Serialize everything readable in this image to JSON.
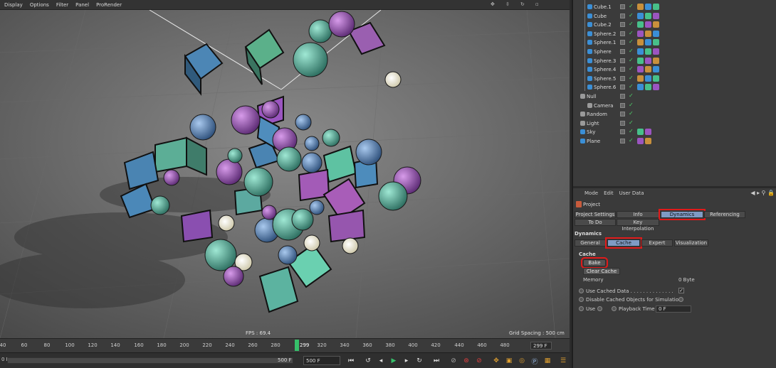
{
  "viewport": {
    "menu": [
      "Display",
      "Options",
      "Filter",
      "Panel",
      "ProRender"
    ],
    "fps": "FPS : 69.4",
    "grid_spacing": "Grid Spacing : 500 cm"
  },
  "timeline": {
    "ticks": [
      "40",
      "60",
      "80",
      "100",
      "120",
      "140",
      "160",
      "180",
      "200",
      "220",
      "240",
      "260",
      "280",
      "300",
      "320",
      "340",
      "360",
      "380",
      "400",
      "420",
      "440",
      "460",
      "480",
      "500"
    ],
    "current_frame": "299",
    "end_field": "299 F"
  },
  "transport": {
    "start": "0 F",
    "range_end": "500 F",
    "max_field": "500 F"
  },
  "objects": [
    {
      "name": "Cube.1",
      "color": "#3b8fd6"
    },
    {
      "name": "Cube",
      "color": "#3b8fd6"
    },
    {
      "name": "Cube.2",
      "color": "#3b8fd6"
    },
    {
      "name": "Sphere.2",
      "color": "#3b8fd6"
    },
    {
      "name": "Sphere.1",
      "color": "#3b8fd6"
    },
    {
      "name": "Sphere",
      "color": "#3b8fd6"
    },
    {
      "name": "Sphere.3",
      "color": "#3b8fd6"
    },
    {
      "name": "Sphere.4",
      "color": "#3b8fd6"
    },
    {
      "name": "Sphere.5",
      "color": "#3b8fd6"
    },
    {
      "name": "Sphere.6",
      "color": "#3b8fd6"
    },
    {
      "name": "Null",
      "color": "#9a9a9a"
    },
    {
      "name": "Camera",
      "color": "#9a9a9a"
    },
    {
      "name": "Random",
      "color": "#9a9a9a"
    },
    {
      "name": "Light",
      "color": "#9a9a9a"
    },
    {
      "name": "Sky",
      "color": "#3b8fd6"
    },
    {
      "name": "Plane",
      "color": "#3b8fd6"
    }
  ],
  "attributes": {
    "menu": [
      "Mode",
      "Edit",
      "User Data"
    ],
    "title": "Project",
    "tabs_row1": [
      "Project Settings",
      "Info",
      "Dynamics",
      "Referencing"
    ],
    "tabs_row2": [
      "To Do",
      "Key Interpolation"
    ],
    "section_dynamics": "Dynamics",
    "subtabs": [
      "General",
      "Cache",
      "Expert",
      "Visualization"
    ],
    "section_cache": "Cache",
    "bake_label": "Bake",
    "clear_cache_label": "Clear Cache",
    "memory_label": "Memory",
    "memory_value": "0 Byte",
    "use_cached_data": "Use Cached Data . . . . . . . . . . . . . .",
    "disable_cached": "Disable Cached Objects for Simulation",
    "use_label": "Use",
    "playback_time_label": "Playback Time",
    "playback_time_value": "0 F"
  },
  "colors": {
    "accent_tab": "#7f9bc4",
    "highlight": "#e01a1a",
    "playhead": "#36c06a"
  }
}
